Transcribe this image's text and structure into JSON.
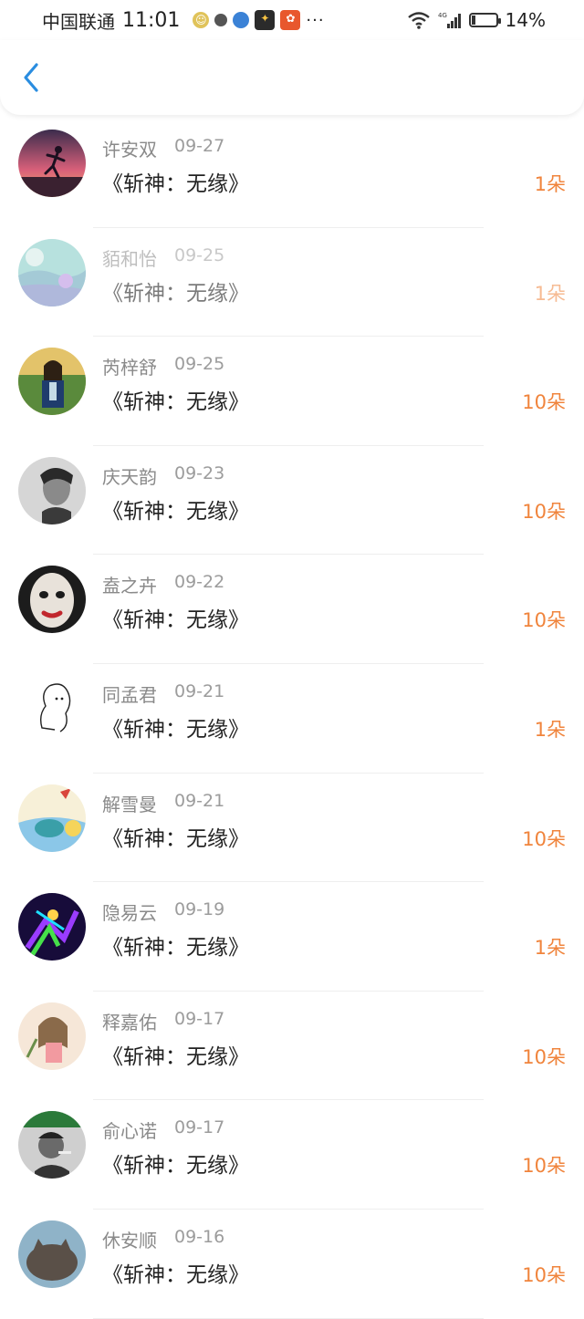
{
  "status_bar": {
    "carrier": "中国联通",
    "time": "11:01",
    "dots": "···",
    "battery_percent": "14%",
    "battery_level": 0.14,
    "icons": [
      "qq-icon",
      "alipay-icon",
      "browser-icon",
      "game-icon",
      "app-icon",
      "wifi-icon",
      "signal-icon",
      "battery-icon"
    ]
  },
  "nav": {
    "back_icon": "chevron-left-icon"
  },
  "colors": {
    "accent": "#f0843c",
    "back": "#2a8de0"
  },
  "items": [
    {
      "name": "许安双",
      "date": "09-27",
      "title": "《斩神：无缘》",
      "amount": "1朵",
      "avatar": "sunset-runner",
      "faded": false
    },
    {
      "name": "貊和怡",
      "date": "09-25",
      "title": "《斩神：无缘》",
      "amount": "1朵",
      "avatar": "teal-landscape",
      "faded": true
    },
    {
      "name": "芮梓舒",
      "date": "09-25",
      "title": "《斩神：无缘》",
      "amount": "10朵",
      "avatar": "girl-outdoors",
      "faded": false
    },
    {
      "name": "庆天韵",
      "date": "09-23",
      "title": "《斩神：无缘》",
      "amount": "10朵",
      "avatar": "bw-portrait",
      "faded": false
    },
    {
      "name": "盍之卉",
      "date": "09-22",
      "title": "《斩神：无缘》",
      "amount": "10朵",
      "avatar": "clown-face",
      "faded": false
    },
    {
      "name": "同孟君",
      "date": "09-21",
      "title": "《斩神：无缘》",
      "amount": "1朵",
      "avatar": "line-sketch",
      "faded": false
    },
    {
      "name": "解雪曼",
      "date": "09-21",
      "title": "《斩神：无缘》",
      "amount": "10朵",
      "avatar": "cartoon-fish",
      "faded": false
    },
    {
      "name": "隐易云",
      "date": "09-19",
      "title": "《斩神：无缘》",
      "amount": "1朵",
      "avatar": "neon-dancer",
      "faded": false
    },
    {
      "name": "释嘉佑",
      "date": "09-17",
      "title": "《斩神：无缘》",
      "amount": "10朵",
      "avatar": "anime-girl",
      "faded": false
    },
    {
      "name": "俞心诺",
      "date": "09-17",
      "title": "《斩神：无缘》",
      "amount": "10朵",
      "avatar": "bw-man-smoking",
      "faded": false
    },
    {
      "name": "休安顺",
      "date": "09-16",
      "title": "《斩神：无缘》",
      "amount": "10朵",
      "avatar": "cat-photo",
      "faded": false
    }
  ]
}
